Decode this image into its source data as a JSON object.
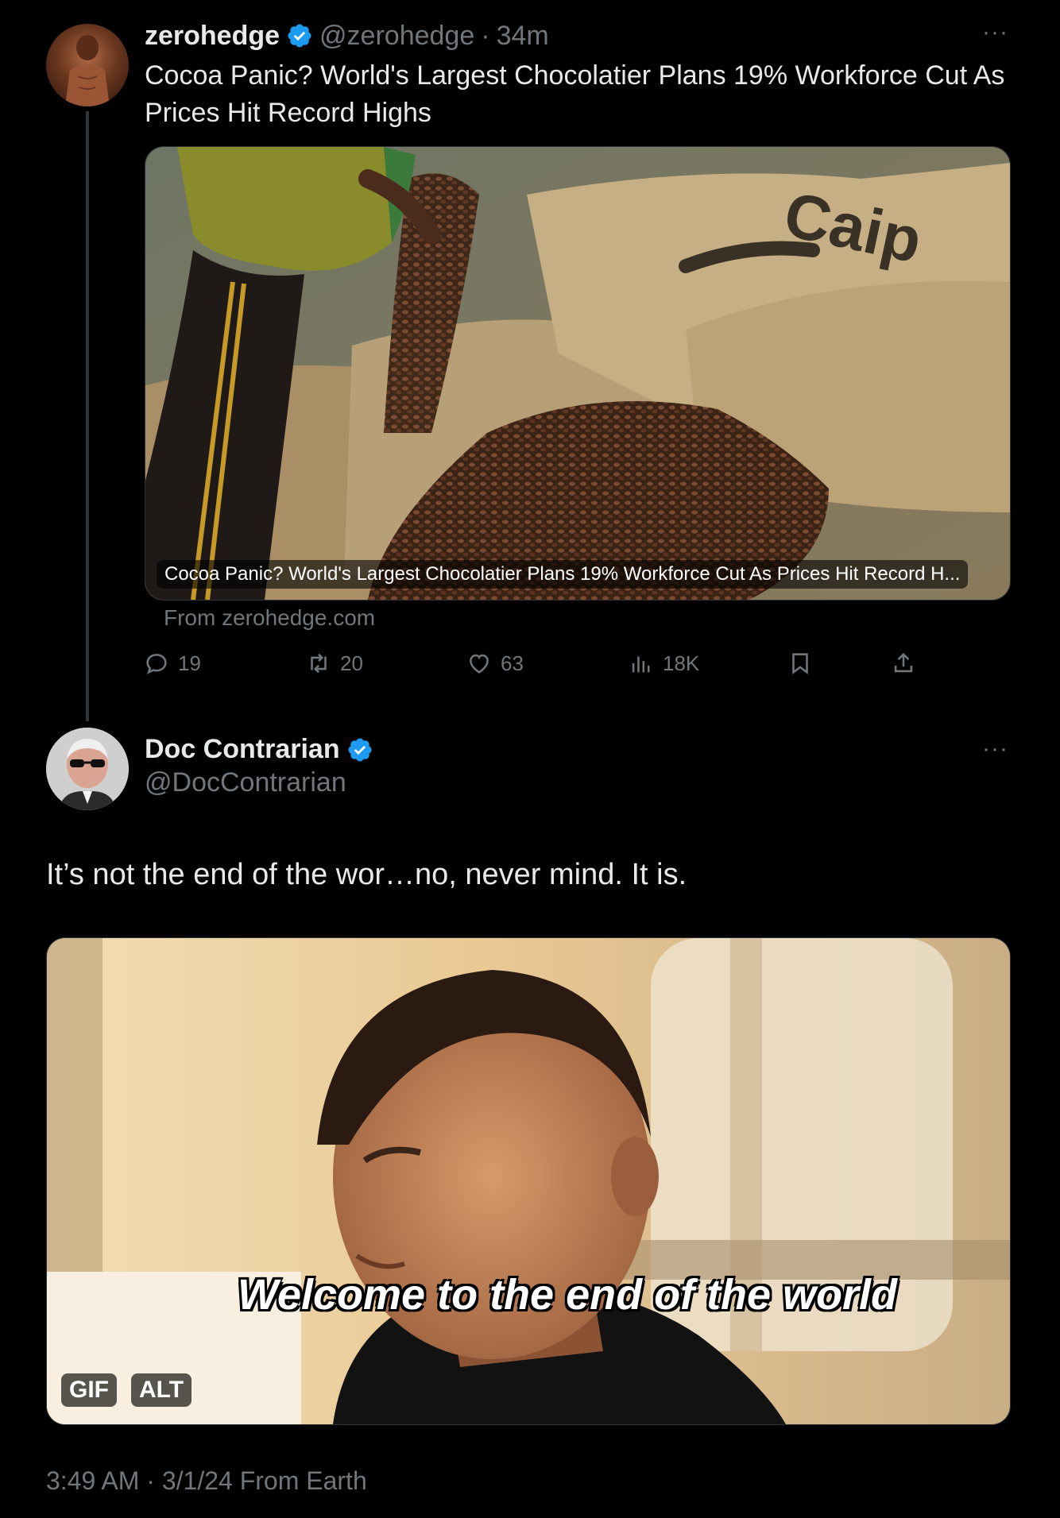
{
  "tweet1": {
    "name": "zerohedge",
    "handle": "@zerohedge",
    "separator": "·",
    "time": "34m",
    "text": "Cocoa Panic? World's Largest Chocolatier Plans 19% Workforce Cut As Prices Hit Record Highs",
    "card_title": "Cocoa Panic? World's Largest Chocolatier Plans 19% Workforce Cut As Prices Hit Record H...",
    "card_source": "From zerohedge.com",
    "more_icon": "more-horizontal-icon",
    "actions": {
      "replies": "19",
      "retweets": "20",
      "likes": "63",
      "views": "18K"
    }
  },
  "tweet2": {
    "name": "Doc Contrarian",
    "handle": "@DocContrarian",
    "text": "It’s not the end of the wor…no, never mind. It is.",
    "gif_caption": "Welcome to the end of the world",
    "badge_gif": "GIF",
    "badge_alt": "ALT",
    "timestamp": "3:49 AM · 3/1/24 From Earth"
  },
  "colors": {
    "background": "#000000",
    "text": "#e7e9ea",
    "muted": "#71767b",
    "verified": "#1d9bf0",
    "thread_line": "#333639"
  }
}
